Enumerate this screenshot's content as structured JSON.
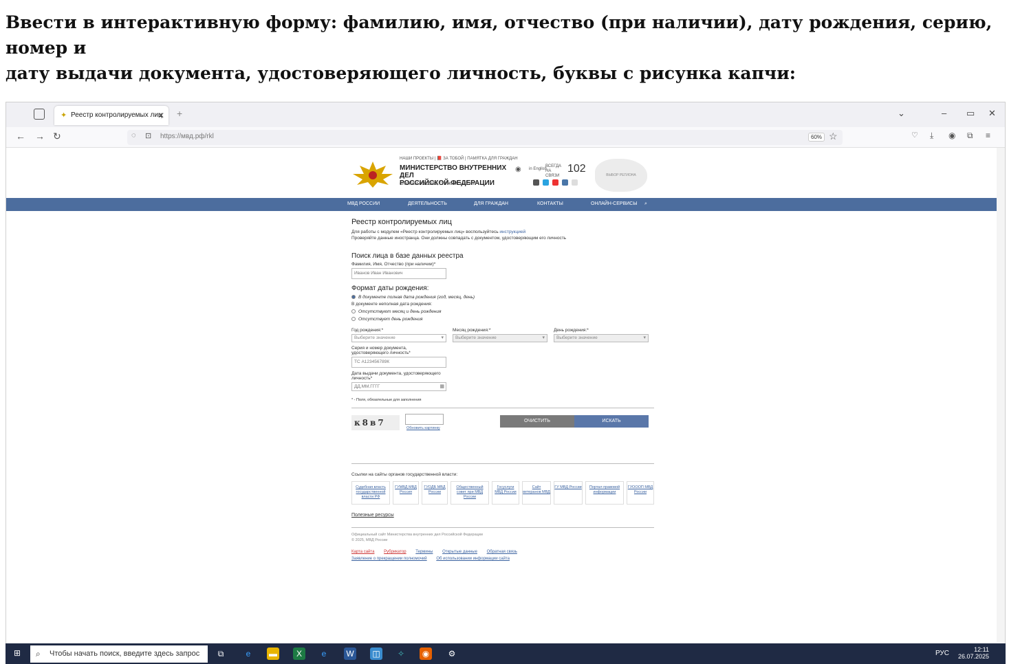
{
  "instruction_line1": "Ввести в интерактивную форму: фамилию, имя, отчество (при наличии), дату рождения, серию, номер и",
  "instruction_line2": "дату выдачи документа, удостоверяющего личность, буквы с рисунка капчи:",
  "browser": {
    "tab_title": "Реестр контролируемых лиц",
    "url": "https://мвд.рф/rkl",
    "zoom": "60%"
  },
  "site": {
    "top_links": "НАШИ ПРОЕКТЫ | 📕 ЗА ТОБОЙ | ПАМЯТКА ДЛЯ ГРАЖДАН",
    "ministry_line1": "МИНИСТЕРСТВО ВНУТРЕННИХ ДЕЛ",
    "ministry_line2": "РОССИЙСКОЙ ФЕДЕРАЦИИ",
    "slogan": "СЛУЖИМ РОССИИ, СЛУЖИМ ЗАКОНУ!",
    "english": "in English",
    "always": "ВСЕГДА НА СВЯЗИ",
    "phone": "102",
    "map_text": "ВЫБОР РЕГИОНА"
  },
  "menu": [
    "МВД РОССИИ",
    "ДЕЯТЕЛЬНОСТЬ",
    "ДЛЯ ГРАЖДАН",
    "КОНТАКТЫ",
    "ОНЛАЙН-СЕРВИСЫ"
  ],
  "form": {
    "title": "Реестр контролируемых лиц",
    "note1_pre": "Для работы с модулем «Реестр контролируемых лиц» воспользуйтесь ",
    "note1_link": "инструкцией",
    "note2": "Проверяйте данные иностранца. Они должны совпадать с документом, удостоверяющим его личность",
    "search_title": "Поиск лица в базе данных реестра",
    "fio_label": "Фамилия, Имя, Отчество (при наличии)*",
    "fio_value": "Иванов Иван Иванович",
    "dob_format_title": "Формат даты рождения:",
    "radio_full": "В документе полная дата рождения (год, месяц, день)",
    "partial_note": "В документе неполная дата рождения:",
    "radio_no_month_day": "Отсутствуют месяц и день рождения",
    "radio_no_day": "Отсутствует день рождения",
    "year_label": "Год рождения:*",
    "month_label": "Месяц рождения:*",
    "day_label": "День рождения:*",
    "select_placeholder": "Выберите значение",
    "doc_label_1": "Серия и номер документа,",
    "doc_label_2": "удостоверяющего личность*",
    "doc_value": "ТС А123456789К",
    "issue_label_1": "Дата выдачи документа, удостоверяющего",
    "issue_label_2": "личность*",
    "issue_placeholder": "ДД.ММ.ГГГГ",
    "required_note": "* - Поля, обязательные для заполнения",
    "captcha_text": "к8в7",
    "refresh_captcha": "Обновить картинку",
    "clear_button": "ОЧИСТИТЬ",
    "search_button": "ИСКАТЬ"
  },
  "gov_links_title": "Ссылки на сайты органов государственной власти:",
  "gov_links": [
    "Судебная власть государственной власти РФ",
    "ГУМВД МВД Россия",
    "ГУОДБ МВД России",
    "Общественный совет при МВД России",
    "Госуслуги МВД России",
    "Сайт ветеранов МВД",
    "ГУ МВД России",
    "Портал правовой информации",
    "ГУОООП МВД России"
  ],
  "useful_resources": "Полезные ресурсы",
  "footer_line1": "Официальный сайт Министерства внутренних дел Российской Федерации",
  "footer_line2": "© 2025, МВД России",
  "footer_links_1": [
    "Карта сайта",
    "Рубрикатор",
    "Термины",
    "Открытые данные",
    "Обратная связь"
  ],
  "footer_links_2": [
    "Заявление о прекращении полномочий",
    "Об использовании информации сайта"
  ],
  "taskbar": {
    "search_placeholder": "Чтобы начать поиск, введите здесь запрос",
    "language": "РУС",
    "time": "12:11",
    "date": "26.07.2025"
  },
  "colors": {
    "menu_blue": "#4c6d9e",
    "taskbar": "#1f2a44"
  }
}
